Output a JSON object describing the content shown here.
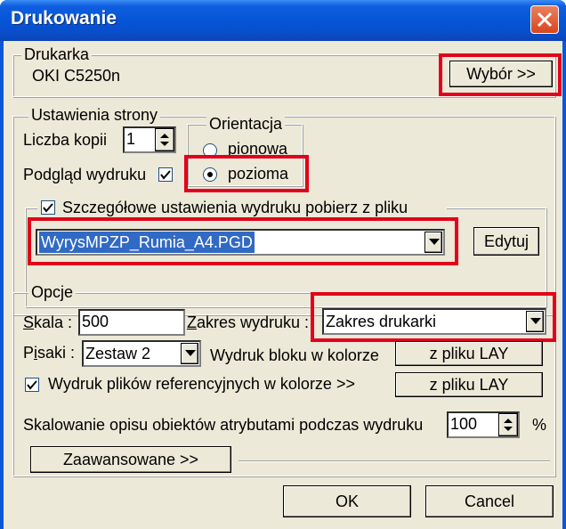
{
  "window": {
    "title": "Drukowanie"
  },
  "printer_group": {
    "label": "Drukarka",
    "printer_name": "OKI C5250n",
    "select_button": "Wybór >>"
  },
  "page_group": {
    "label": "Ustawienia strony",
    "copies_label": "Liczba kopii",
    "copies_value": "1",
    "preview_label": "Podgląd wydruku",
    "preview_checked": true,
    "orientation": {
      "label": "Orientacja",
      "portrait": "pionowa",
      "landscape": "pozioma",
      "selected": "pozioma"
    },
    "detail_label": "Szczegółowe ustawienia wydruku pobierz z pliku",
    "detail_checked": true,
    "file_value": "WyrysMPZP_Rumia_A4.PGD",
    "edit_button": "Edytuj"
  },
  "options_group": {
    "label": "Opcje",
    "scale_label_u": "S",
    "scale_label_rest": "kala :",
    "scale_value": "500",
    "range_label_u": "Z",
    "range_label_rest": "akres wydruku :",
    "range_value": "Zakres drukarki",
    "pens_label_a": "P",
    "pens_label_u": "i",
    "pens_label_rest": "saki :",
    "pens_value": "Zestaw 2",
    "block_color_label": "Wydruk bloku w kolorze",
    "block_color_button": "z pliku LAY",
    "ref_color_label": "Wydruk plików referencyjnych w kolorze >>",
    "ref_color_checked": true,
    "ref_color_button": "z pliku LAY",
    "scaling_label": "Skalowanie opisu obiektów atrybutami podczas wydruku",
    "scaling_value": "100",
    "scaling_unit": "%",
    "advanced_button": "Zaawansowane >>"
  },
  "footer": {
    "ok_button": "OK",
    "cancel_button": "Cancel"
  },
  "colors": {
    "title_bar": "#0554d6",
    "highlight": "#e2001a",
    "dialog_bg": "#ece9d8",
    "selection": "#316ac5"
  }
}
